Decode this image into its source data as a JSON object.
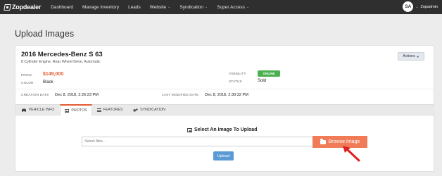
{
  "nav": {
    "logo": "Zopdealer",
    "items": [
      {
        "label": "Dashboard",
        "caret": false
      },
      {
        "label": "Manage Inventory",
        "caret": false
      },
      {
        "label": "Leads",
        "caret": false
      },
      {
        "label": "Website",
        "caret": true
      },
      {
        "label": "Syndication",
        "caret": true
      },
      {
        "label": "Super Access",
        "caret": true
      }
    ],
    "user_initials": "SA",
    "user_name": "Zopadmin"
  },
  "page_title": "Upload Images",
  "vehicle": {
    "title": "2016 Mercedes-Benz S 63",
    "subtitle": "8 Cylinder Engine, Rear Wheel Drive, Automatic",
    "actions_label": "Actions",
    "price_label": "PRICE",
    "price": "$149,000",
    "color_label": "COLOR",
    "color": "Black",
    "visibility_label": "VISIBILITY",
    "visibility": "ONLINE",
    "status_label": "STATUS",
    "status": "Sold",
    "creation_label": "CREATION DATE",
    "creation_date": "Dec 8, 2018, 2:26:23 PM",
    "modified_label": "LAST MODIFIED DATE",
    "modified_date": "Dec 8, 2018, 2:30:32 PM"
  },
  "tabs": [
    {
      "label": "VEHICLE INFO",
      "icon": "car-icon",
      "active": false
    },
    {
      "label": "PHOTOS",
      "icon": "photo-icon",
      "active": true
    },
    {
      "label": "FEATURES",
      "icon": "list-icon",
      "active": false
    },
    {
      "label": "SYNDICATION",
      "icon": "cogs-icon",
      "active": false
    }
  ],
  "upload": {
    "heading": "Select An Image To Upload",
    "file_placeholder": "Select files...",
    "browse_label": "Browse Image",
    "upload_label": "Upload"
  },
  "colors": {
    "nav_bg": "#2f2f2f",
    "accent_orange": "#f07b56",
    "price": "#e35b32",
    "online_badge": "#4cb050",
    "upload_button": "#5b9bd5",
    "arrow": "#e02020"
  }
}
